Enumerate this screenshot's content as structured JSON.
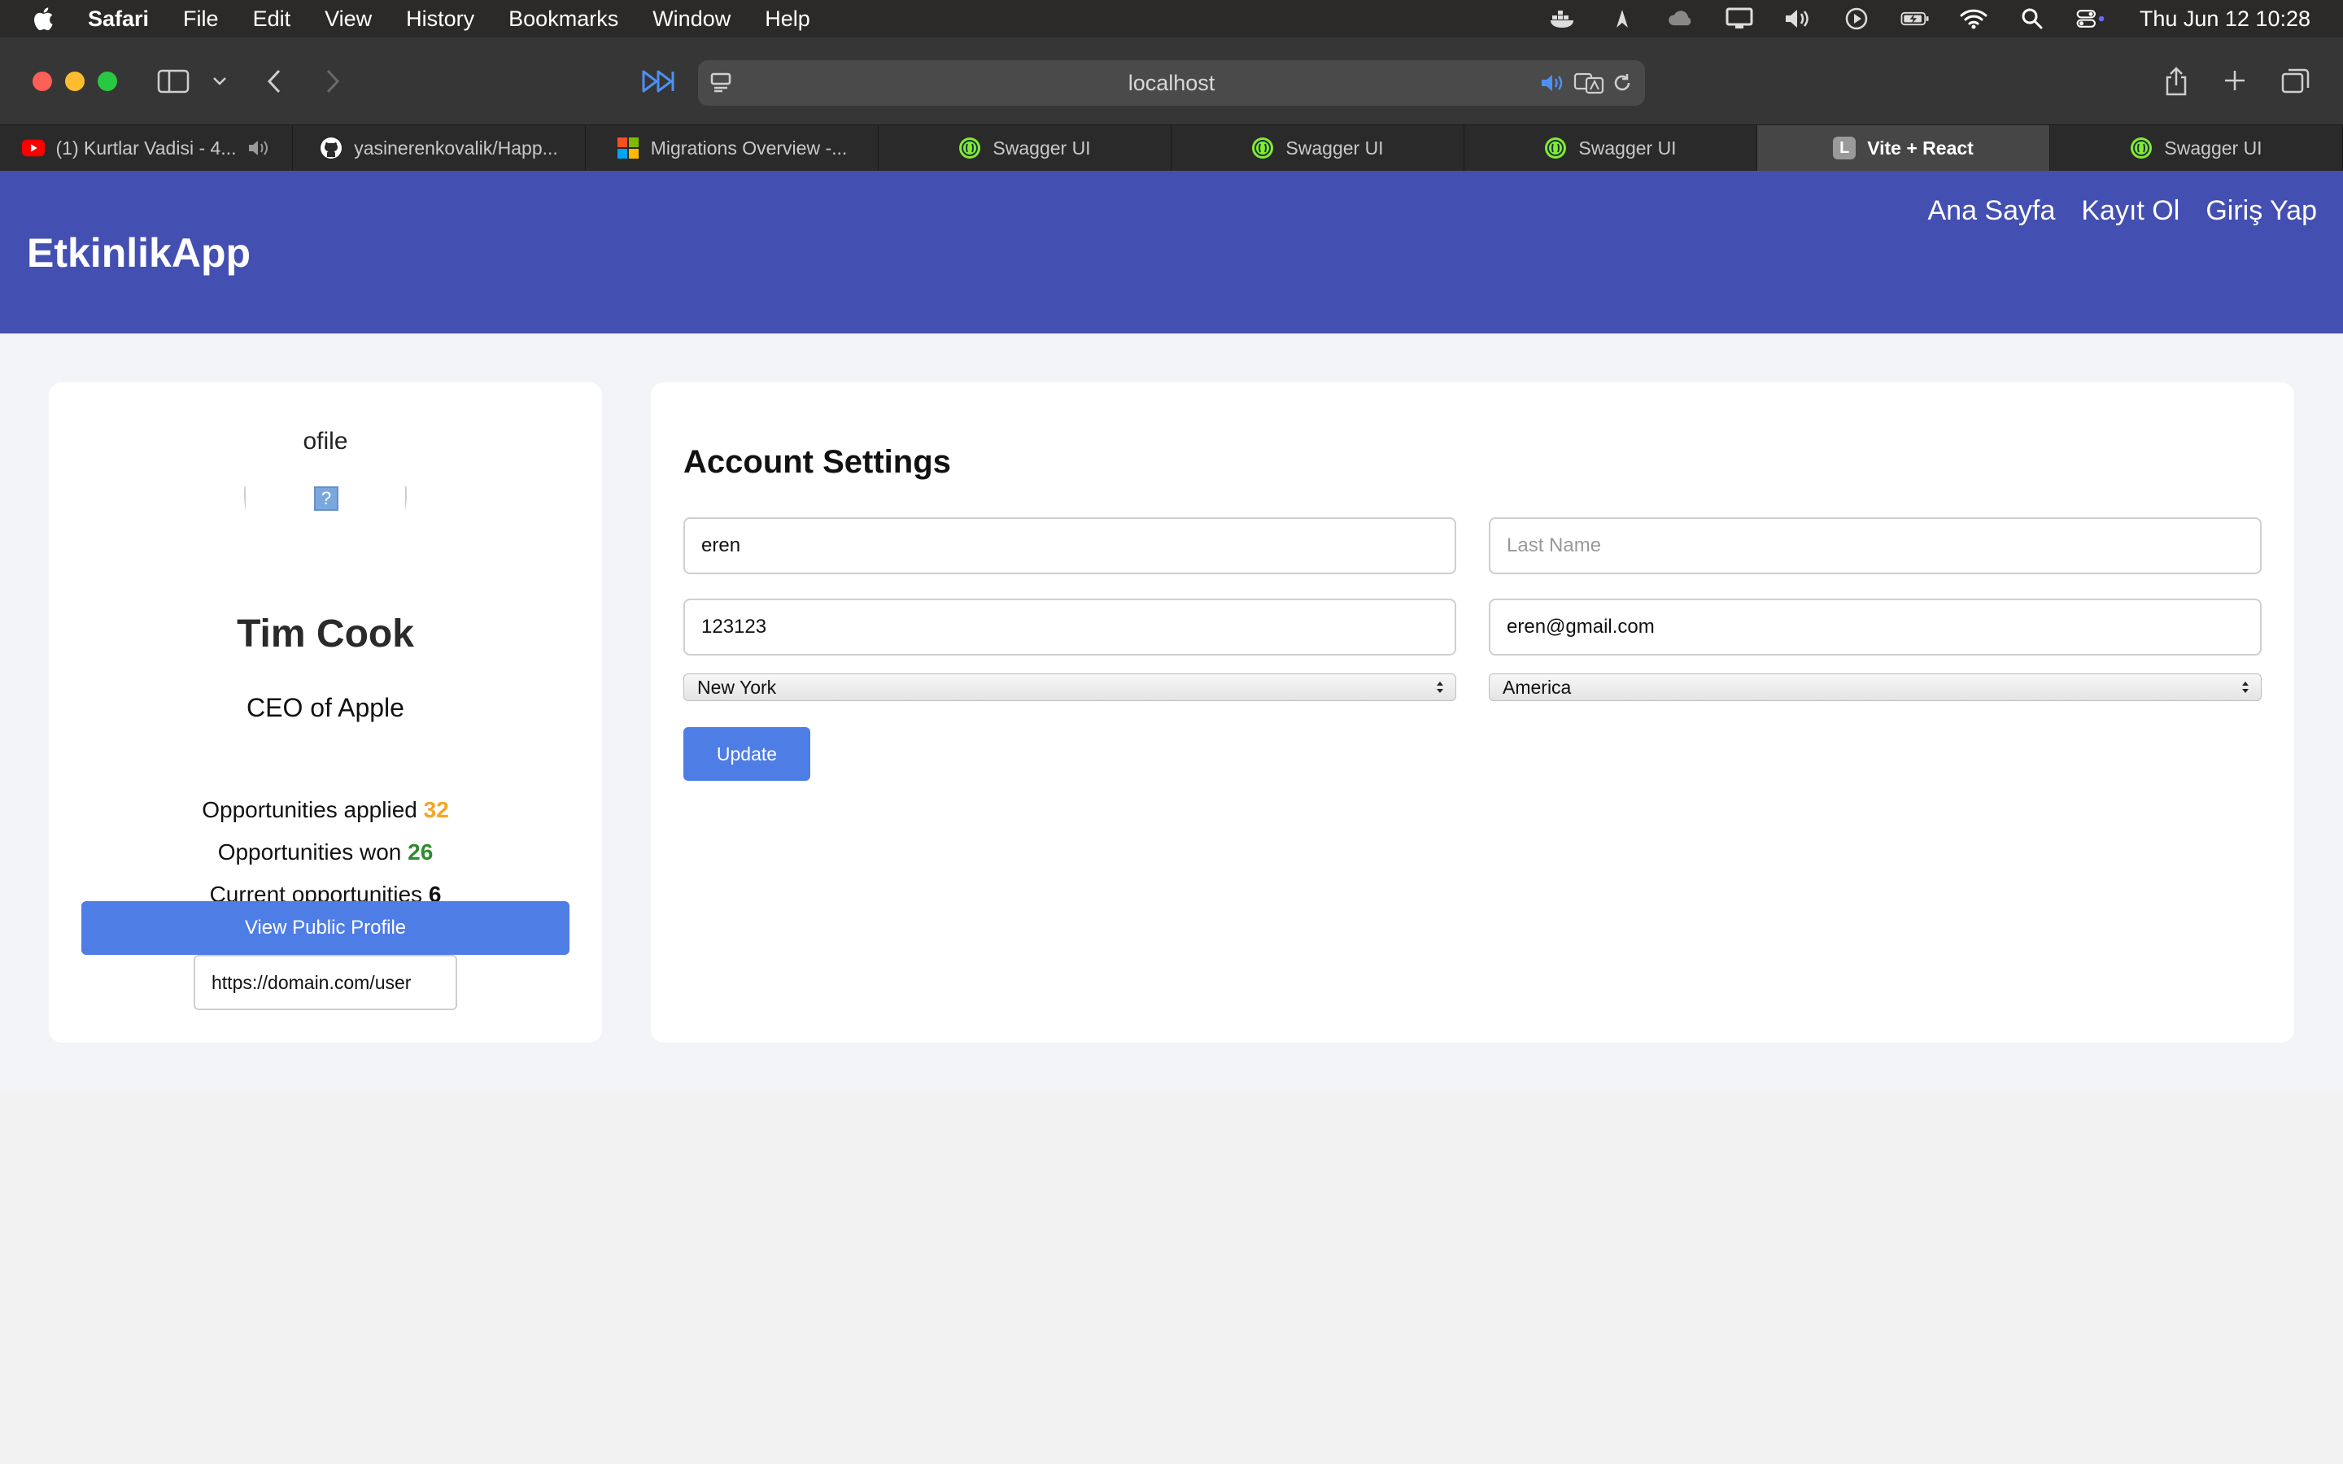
{
  "menubar": {
    "app": "Safari",
    "items": [
      "File",
      "Edit",
      "View",
      "History",
      "Bookmarks",
      "Window",
      "Help"
    ],
    "clock": "Thu Jun 12  10:28"
  },
  "browser": {
    "url": "localhost",
    "tabs": [
      {
        "label": "(1) Kurtlar Vadisi - 4...",
        "icon": "youtube-icon"
      },
      {
        "label": "yasinerenkovalik/Happ...",
        "icon": "github-icon"
      },
      {
        "label": "Migrations Overview -...",
        "icon": "microsoft-icon"
      },
      {
        "label": "Swagger UI",
        "icon": "swagger-icon"
      },
      {
        "label": "Swagger UI",
        "icon": "swagger-icon"
      },
      {
        "label": "Swagger UI",
        "icon": "swagger-icon"
      },
      {
        "label": "Vite + React",
        "icon": "letter-l-icon",
        "letter": "L"
      },
      {
        "label": "Swagger UI",
        "icon": "swagger-icon"
      }
    ]
  },
  "site": {
    "brand": "EtkinlikApp",
    "nav": [
      "Ana Sayfa",
      "Kayıt Ol",
      "Giriş Yap"
    ],
    "colors": {
      "header": "#444fb2",
      "primary": "#4f7de6",
      "orange": "#f5a524",
      "green": "#2e8a2e"
    }
  },
  "profile": {
    "avatar_alt": "ofile",
    "name": "Tim Cook",
    "title": "CEO of Apple",
    "stats": [
      {
        "label": "Opportunities applied",
        "value": "32"
      },
      {
        "label": "Opportunities won",
        "value": "26"
      },
      {
        "label": "Current opportunities",
        "value": "6"
      }
    ],
    "view_button": "View Public Profile",
    "public_url": "https://domain.com/user"
  },
  "settings": {
    "title": "Account Settings",
    "first_name": "eren",
    "last_name_placeholder": "Last Name",
    "phone": "123123",
    "email": "eren@gmail.com",
    "city": "New York",
    "country": "America",
    "update_button": "Update"
  }
}
